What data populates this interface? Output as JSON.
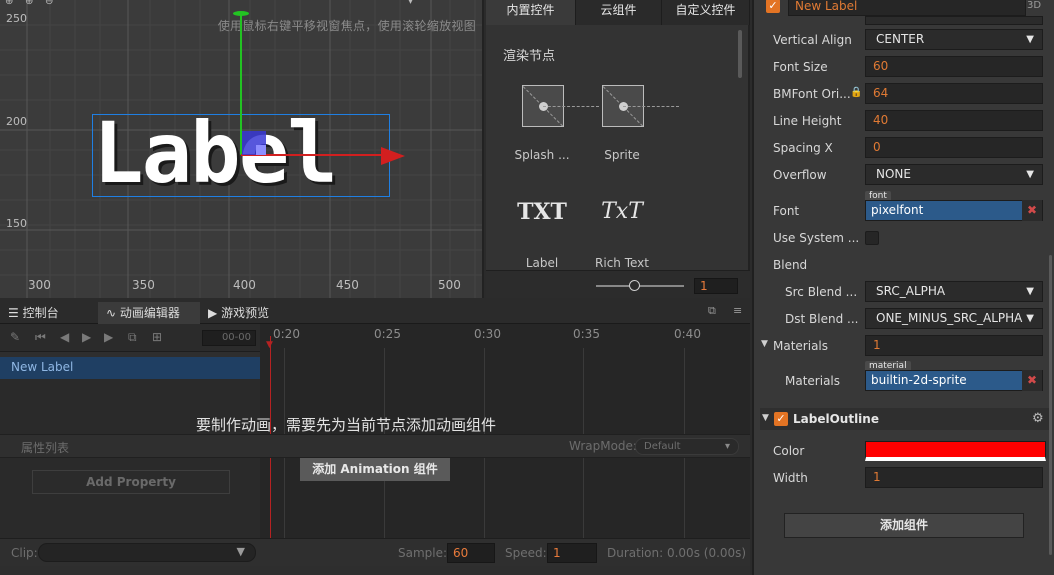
{
  "scene": {
    "hint": "使用鼠标右键平移视窗焦点，使用滚轮缩放视图",
    "y_labels": [
      "250",
      "200",
      "150"
    ],
    "x_labels": [
      "300",
      "350",
      "400",
      "450",
      "500"
    ],
    "label_text": "Label",
    "colors": {
      "x_axis": "#d21f1f",
      "y_axis": "#22c322",
      "selection": "#1f7fe3"
    }
  },
  "palette": {
    "tabs": [
      "内置控件",
      "云组件",
      "自定义控件"
    ],
    "section_title": "渲染节点",
    "items": [
      {
        "label": "Splash ...",
        "icon": "sprite-placeholder-icon"
      },
      {
        "label": "Sprite",
        "icon": "sprite-placeholder-icon"
      },
      {
        "label": "Label",
        "glyph": "TXT"
      },
      {
        "label": "Rich Text",
        "glyph": "TxT"
      }
    ],
    "zoom_value": "1"
  },
  "bottom": {
    "tabs": [
      "控制台",
      "动画编辑器",
      "游戏预览"
    ],
    "time_field": "00-00",
    "ticks": [
      "0:20",
      "0:25",
      "0:30",
      "0:35",
      "0:40"
    ],
    "node_name": "New Label",
    "message": "要制作动画，需要先为当前节点添加动画组件",
    "prop_list_label": "属性列表",
    "wrapmode_label": "WrapMode:",
    "wrapmode_value": "Default",
    "add_property": "Add Property",
    "add_anim": "添加 Animation 组件",
    "clip_label": "Clip:",
    "sample_label": "Sample:",
    "sample_value": "60",
    "speed_label": "Speed:",
    "speed_value": "1",
    "duration": "Duration: 0.00s (0.00s)"
  },
  "inspector": {
    "node_name": "New Label",
    "badge_3d": "3D",
    "vertical_align_label": "Vertical Align",
    "vertical_align_value": "CENTER",
    "font_size_label": "Font Size",
    "font_size_value": "60",
    "bmfont_label": "BMFont Ori...",
    "bmfont_value": "64",
    "line_height_label": "Line Height",
    "line_height_value": "40",
    "spacing_label": "Spacing X",
    "spacing_value": "0",
    "overflow_label": "Overflow",
    "overflow_value": "NONE",
    "font_tag": "font",
    "font_label": "Font",
    "font_value": "pixelfont",
    "use_system_label": "Use System ...",
    "blend_label": "Blend",
    "src_blend_label": "Src Blend ...",
    "src_blend_value": "SRC_ALPHA",
    "dst_blend_label": "Dst Blend ...",
    "dst_blend_value": "ONE_MINUS_SRC_ALPHA",
    "materials_label": "Materials",
    "materials_count": "1",
    "material_tag": "material",
    "materials_item_label": "Materials",
    "material_value": "builtin-2d-sprite",
    "outline_title": "LabelOutline",
    "color_label": "Color",
    "color_value": "#ff0000",
    "width_label": "Width",
    "width_value": "1",
    "add_component": "添加组件"
  }
}
